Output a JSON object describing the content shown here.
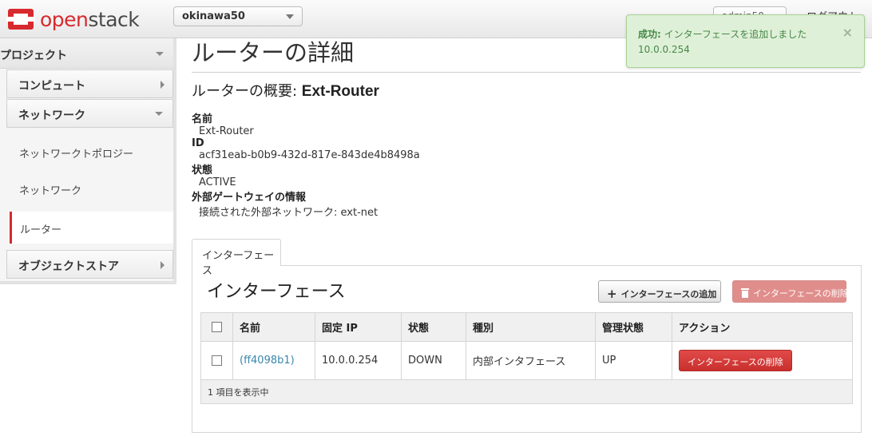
{
  "brand": {
    "prefix": "open",
    "suffix": "stack"
  },
  "header": {
    "project": "okinawa50",
    "user": "admin50",
    "logout": "ログアウト"
  },
  "sidebar": {
    "project_label": "プロジェクト",
    "compute_label": "コンピュート",
    "network_label": "ネットワーク",
    "items": [
      "ネットワークトポロジー",
      "ネットワーク",
      "ルーター"
    ],
    "object_store_label": "オブジェクトストア"
  },
  "page": {
    "title": "ルーターの詳細",
    "summary_prefix": "ルーターの概要: ",
    "summary_name": "Ext-Router"
  },
  "details": {
    "name_label": "名前",
    "name_value": "Ext-Router",
    "id_label": "ID",
    "id_value": "acf31eab-b0b9-432d-817e-843de4b8498a",
    "status_label": "状態",
    "status_value": "ACTIVE",
    "gateway_label": "外部ゲートウェイの情報",
    "gateway_value": "接続された外部ネットワーク: ext-net"
  },
  "tab": {
    "label": "インターフェース"
  },
  "interfaces": {
    "title": "インターフェース",
    "add_button": "インターフェースの追加",
    "delete_button": "インターフェースの削除",
    "columns": [
      "名前",
      "固定 IP",
      "状態",
      "種別",
      "管理状態",
      "アクション"
    ],
    "rows": [
      {
        "name": "(ff4098b1)",
        "ip": "10.0.0.254",
        "status": "DOWN",
        "type": "内部インタフェース",
        "admin_state": "UP",
        "action": "インターフェースの削除"
      }
    ],
    "footer": "1 項目を表示中"
  },
  "alert": {
    "title": "成功:",
    "message": " インターフェースを追加しました",
    "detail": "10.0.0.254"
  },
  "colors": {
    "accent": "#d72a2e",
    "success_bg": "#dff0d8",
    "success_text": "#468847",
    "link": "#3a87ad"
  }
}
